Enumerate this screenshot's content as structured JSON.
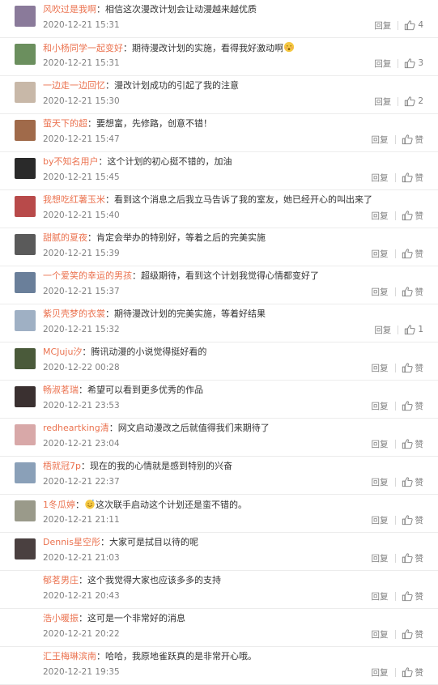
{
  "comments": [
    {
      "user": "风吹过是我啊",
      "text": "相信这次漫改计划会让动漫越来越优质",
      "time": "2020-12-21 15:31",
      "reply": "回复",
      "likes": "4",
      "avatar_color": "#8a7a9a",
      "emoji": ""
    },
    {
      "user": "和小杨同学一起变好",
      "text": "期待漫改计划的实施，看得我好激动啊",
      "time": "2020-12-21 15:31",
      "reply": "回复",
      "likes": "3",
      "avatar_color": "#6b8f5e",
      "emoji": "smile"
    },
    {
      "user": "一边走一边回忆",
      "text": "漫改计划成功的引起了我的注意",
      "time": "2020-12-21 15:30",
      "reply": "回复",
      "likes": "2",
      "avatar_color": "#c8b8a8",
      "emoji": ""
    },
    {
      "user": "萤天下的超",
      "text": "要想富，先修路，创意不错！",
      "time": "2020-12-21 15:47",
      "reply": "回复",
      "likes": "赞",
      "avatar_color": "#a06a4a",
      "emoji": ""
    },
    {
      "user": "by不知名用户",
      "text": "这个计划的初心挺不错的，加油",
      "time": "2020-12-21 15:45",
      "reply": "回复",
      "likes": "赞",
      "avatar_color": "#2a2a2a",
      "emoji": ""
    },
    {
      "user": "我想吃红薯玉米",
      "text": "看到这个消息之后我立马告诉了我的室友，她已经开心的叫出来了",
      "time": "2020-12-21 15:40",
      "reply": "回复",
      "likes": "赞",
      "avatar_color": "#b84a4a",
      "emoji": ""
    },
    {
      "user": "甜腻的夏夜",
      "text": "肯定会举办的特别好，等着之后的完美实施",
      "time": "2020-12-21 15:39",
      "reply": "回复",
      "likes": "赞",
      "avatar_color": "#5a5a5a",
      "emoji": ""
    },
    {
      "user": "一个爱笑的幸运的男孩",
      "text": "超级期待，看到这个计划我觉得心情都变好了",
      "time": "2020-12-21 15:37",
      "reply": "回复",
      "likes": "赞",
      "avatar_color": "#6a7f9a",
      "emoji": ""
    },
    {
      "user": "紫贝壳梦的衣裳",
      "text": "期待漫改计划的完美实施，等着好结果",
      "time": "2020-12-21 15:32",
      "reply": "回复",
      "likes": "1",
      "avatar_color": "#9fb0c4",
      "emoji": ""
    },
    {
      "user": "MCJuju汐",
      "text": "腾讯动漫的小说觉得挺好看的",
      "time": "2020-12-22 00:28",
      "reply": "回复",
      "likes": "赞",
      "avatar_color": "#4a5a3a",
      "emoji": ""
    },
    {
      "user": "畅淑茗瑞",
      "text": "希望可以看到更多优秀的作品",
      "time": "2020-12-21 23:53",
      "reply": "回复",
      "likes": "赞",
      "avatar_color": "#3a3030",
      "emoji": ""
    },
    {
      "user": "redheartking清",
      "text": "网文启动漫改之后就值得我们来期待了",
      "time": "2020-12-21 23:04",
      "reply": "回复",
      "likes": "赞",
      "avatar_color": "#d8a8a8",
      "emoji": ""
    },
    {
      "user": "梧就冠7p",
      "text": "现在的我的心情就是感到特别的兴奋",
      "time": "2020-12-21 22:37",
      "reply": "回复",
      "likes": "赞",
      "avatar_color": "#8aa0b8",
      "emoji": ""
    },
    {
      "user": "1冬瓜婷",
      "text": "这次联手启动这个计划还是蛮不错的。",
      "time": "2020-12-21 21:11",
      "reply": "回复",
      "likes": "赞",
      "avatar_color": "#9a9a8a",
      "emoji": "sweat"
    },
    {
      "user": "Dennis星空彤",
      "text": "大家可是拭目以待的呢",
      "time": "2020-12-21 21:03",
      "reply": "回复",
      "likes": "赞",
      "avatar_color": "#4a4040",
      "emoji": ""
    },
    {
      "user": "郁茗男庄",
      "text": "这个我觉得大家也应该多多的支持",
      "time": "2020-12-21 20:43",
      "reply": "回复",
      "likes": "赞",
      "avatar_color": "#ffffff",
      "emoji": ""
    },
    {
      "user": "浩小暖振",
      "text": "这可是一个非常好的消息",
      "time": "2020-12-21 20:22",
      "reply": "回复",
      "likes": "赞",
      "avatar_color": "#ffffff",
      "emoji": ""
    },
    {
      "user": "汇王梅琳滨南",
      "text": "哈哈，我原地雀跃真的是非常开心哦。",
      "time": "2020-12-21 19:35",
      "reply": "回复",
      "likes": "赞",
      "avatar_color": "#ffffff",
      "emoji": ""
    }
  ],
  "colors": {
    "username": "#eb7350",
    "text": "#333333",
    "meta": "#808080",
    "divider": "#ececec"
  }
}
